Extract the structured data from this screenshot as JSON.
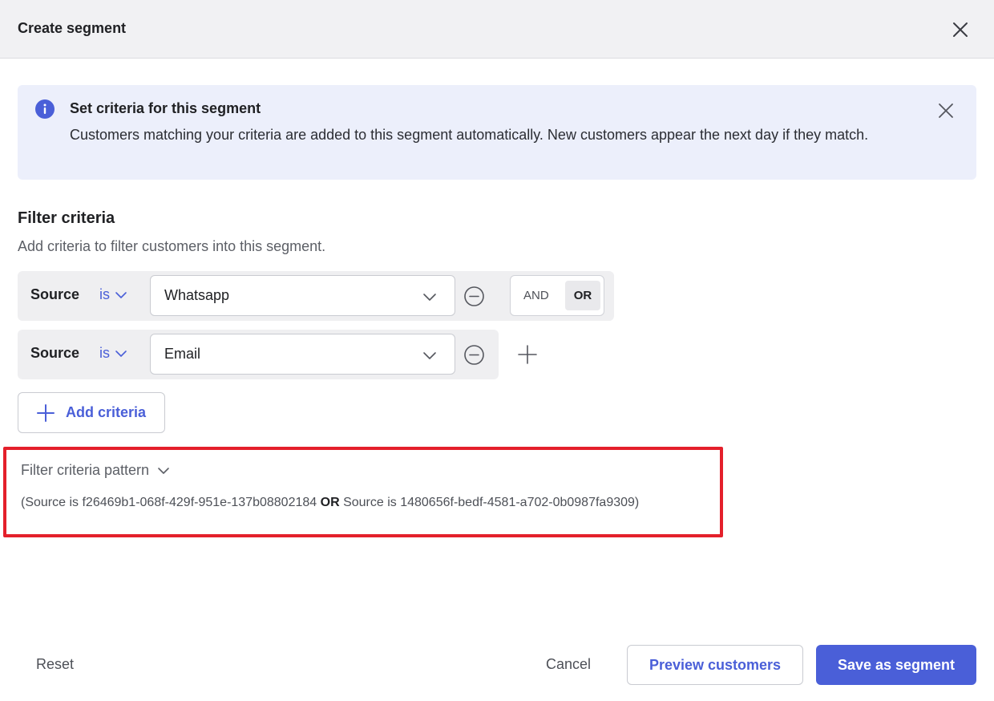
{
  "dialog": {
    "title": "Create segment"
  },
  "banner": {
    "title": "Set criteria for this segment",
    "body": "Customers matching your criteria are added to this segment automatically. New customers appear the next day if they match."
  },
  "filter": {
    "title": "Filter criteria",
    "description": "Add criteria to filter customers into this segment.",
    "criteria": [
      {
        "field": "Source",
        "operator": "is",
        "value": "Whatsapp"
      },
      {
        "field": "Source",
        "operator": "is",
        "value": "Email"
      }
    ],
    "logic": {
      "and_label": "AND",
      "or_label": "OR",
      "selected": "OR"
    },
    "add_criteria_label": "Add criteria"
  },
  "pattern": {
    "toggle_label": "Filter criteria pattern",
    "part1": "(Source is f26469b1-068f-429f-951e-137b08802184 ",
    "operator": "OR",
    "part2": " Source is 1480656f-bedf-4581-a702-0b0987fa9309)"
  },
  "footer": {
    "reset_label": "Reset",
    "cancel_label": "Cancel",
    "preview_label": "Preview customers",
    "save_label": "Save as segment"
  },
  "colors": {
    "accent": "#4a5fd8",
    "highlight_border": "#e4202b"
  }
}
